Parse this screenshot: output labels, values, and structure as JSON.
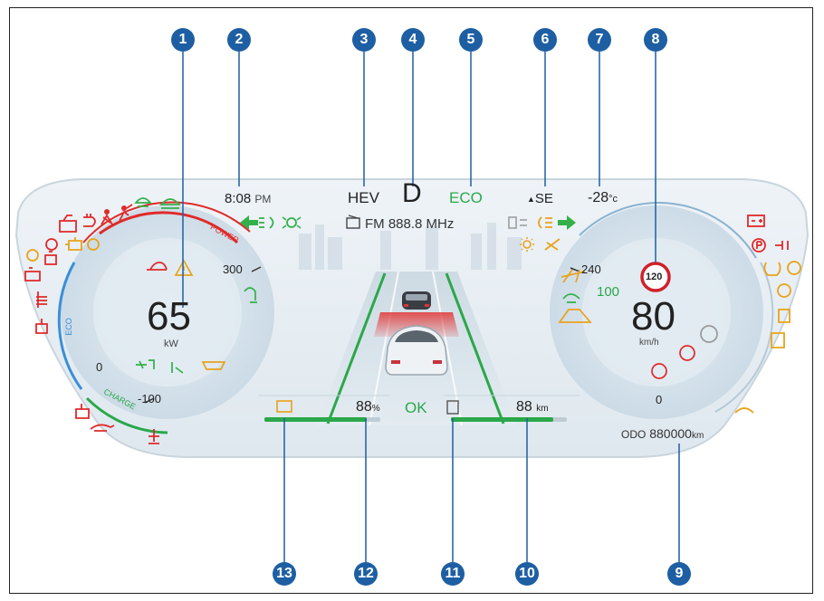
{
  "callouts": [
    "1",
    "2",
    "3",
    "4",
    "5",
    "6",
    "7",
    "8",
    "9",
    "10",
    "11",
    "12",
    "13"
  ],
  "cluster": {
    "time": {
      "value": "8:08",
      "suffix": "PM"
    },
    "mode": "HEV",
    "gear": "D",
    "drive_mode": "ECO",
    "compass": "SE",
    "temperature": {
      "value": "-28",
      "unit": "°c"
    },
    "radio": "FM 888.8 MHz",
    "power_gauge": {
      "value": "65",
      "unit": "kW",
      "tick_max": "300",
      "tick_zero": "0",
      "tick_min": "-100",
      "arc_power": "POWER",
      "arc_eco": "ECO",
      "arc_charge": "CHARGE"
    },
    "speed_gauge": {
      "value": "80",
      "unit": "km/h",
      "tick_max": "240",
      "tick_zero": "0",
      "speed_limit": "120",
      "acc_speed": "100"
    },
    "battery_soc": {
      "value": "88",
      "unit": "%",
      "status": "OK"
    },
    "range": {
      "value": "88",
      "unit": "km"
    },
    "odometer": {
      "label": "ODO",
      "value": "880000",
      "unit": "km"
    }
  },
  "colors": {
    "callout": "#1e5fa3",
    "warning_red": "#e02a2a",
    "amber": "#e8a21c",
    "indicator_green": "#33b04a",
    "eco_green": "#2aa84a",
    "cluster_bg": "#e6eef4",
    "gauge_bg": "#d7e4ee"
  },
  "icons": {
    "left_group": [
      "car-door-icon",
      "plug-icon",
      "seatbelt-icon",
      "airbag-icon",
      "traction-icon",
      "skid-icon",
      "brake-icon",
      "engine-icon",
      "oil-level-icon",
      "glow-plug-icon",
      "coolant-icon",
      "oil-pressure-icon",
      "battery-temp-icon"
    ],
    "right_group": [
      "battery-icon",
      "parking-brake-icon",
      "charge-port-icon",
      "tpms-icon",
      "brake-wear-icon",
      "lamp-fault-icon",
      "rear-seat-icon",
      "occupant-icon",
      "washer-icon"
    ],
    "top_indicators": [
      "turn-left-icon",
      "high-beam-icon",
      "position-lamp-icon",
      "auto-beam-icon",
      "rear-fog-icon",
      "turn-right-icon",
      "sun-icon",
      "wiper-icon"
    ]
  }
}
